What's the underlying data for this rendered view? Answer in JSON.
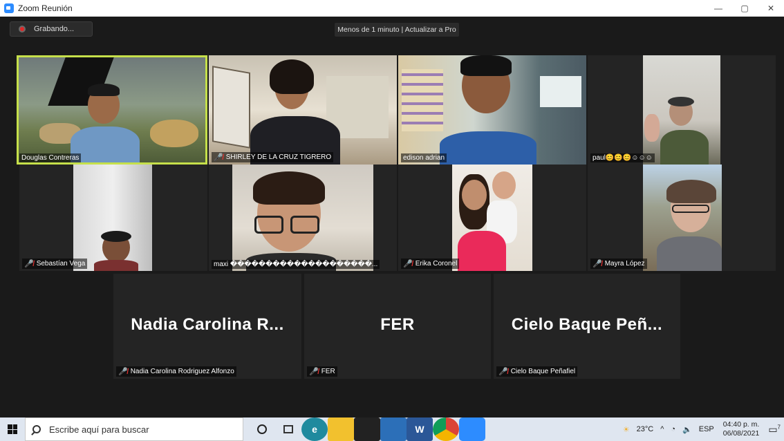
{
  "window": {
    "title": "Zoom Reunión",
    "controls": [
      "—",
      "▢",
      "✕"
    ]
  },
  "toolbar": {
    "recording_label": "Grabando...",
    "upgrade_text": "Menos de 1 minuto | Actualizar a Pro"
  },
  "participants": [
    {
      "name": "Douglas Contreras",
      "muted": false,
      "active": true
    },
    {
      "name": "SHIRLEY DE LA CRUZ TIGRERO",
      "muted": true
    },
    {
      "name": "edison adrian",
      "muted": false
    },
    {
      "name": "paul😊😊😊☺☺☺",
      "muted": false
    },
    {
      "name": "Sebastían Vega",
      "muted": true
    },
    {
      "name": "maxi ��������������������...",
      "muted": false
    },
    {
      "name": "Erika Coronel",
      "muted": true
    },
    {
      "name": "Mayra López",
      "muted": true
    },
    {
      "name": "Nadia Carolina Rodriguez Alfonzo",
      "display": "Nadia Carolina R...",
      "muted": true
    },
    {
      "name": "FER",
      "display": "FER",
      "muted": true
    },
    {
      "name": "Cielo Baque Peñafiel",
      "display": "Cielo Baque Peñ...",
      "muted": true
    }
  ],
  "taskbar": {
    "search_placeholder": "Escribe aquí para buscar",
    "weather": "23°C",
    "language": "ESP",
    "time": "04:40 p. m.",
    "date": "06/08/2021",
    "notification_count": "7"
  },
  "colors": {
    "active_speaker": "#c6e04a",
    "muted_icon": "#e33333",
    "zoom_blue": "#2d8cff"
  }
}
